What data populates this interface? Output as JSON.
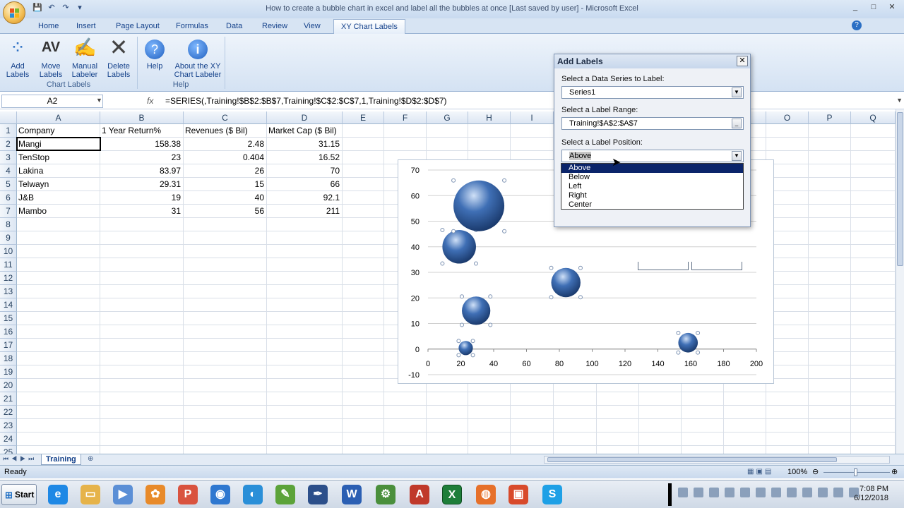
{
  "window": {
    "title": "How to create a bubble chart in excel and label all the bubbles at once [Last saved by user] - Microsoft Excel",
    "controls": [
      "_",
      "□",
      "✕"
    ]
  },
  "ribbon_tabs": [
    "Home",
    "Insert",
    "Page Layout",
    "Formulas",
    "Data",
    "Review",
    "View",
    "XY Chart Labels"
  ],
  "active_tab": "XY Chart Labels",
  "ribbon": {
    "chart_labels": {
      "group": "Chart Labels",
      "buttons": [
        {
          "icon": "add-labels-icon",
          "label1": "Add",
          "label2": "Labels"
        },
        {
          "icon": "move-labels-icon",
          "label1": "Move",
          "label2": "Labels"
        },
        {
          "icon": "manual-labeler-icon",
          "label1": "Manual",
          "label2": "Labeler"
        },
        {
          "icon": "delete-labels-icon",
          "label1": "Delete",
          "label2": "Labels"
        }
      ]
    },
    "help": {
      "group": "Help",
      "buttons": [
        {
          "icon": "help-icon",
          "label1": "Help",
          "label2": ""
        },
        {
          "icon": "info-icon",
          "label1": "About the XY",
          "label2": "Chart Labeler"
        }
      ]
    }
  },
  "formula_bar": {
    "name_box": "A2",
    "fx": "fx",
    "formula": "=SERIES(,Training!$B$2:$B$7,Training!$C$2:$C$7,1,Training!$D$2:$D$7)"
  },
  "columns": [
    "A",
    "B",
    "C",
    "D",
    "E",
    "F",
    "G",
    "H",
    "I",
    "J",
    "K",
    "L",
    "M",
    "N",
    "O",
    "P",
    "Q"
  ],
  "rows": [
    "1",
    "2",
    "3",
    "4",
    "5",
    "6",
    "7",
    "8",
    "9",
    "10",
    "11",
    "12",
    "13",
    "14",
    "15",
    "16",
    "17",
    "18",
    "19",
    "20",
    "21",
    "22",
    "23",
    "24",
    "25"
  ],
  "table": {
    "headers": [
      "Company",
      "1 Year Return%",
      "Revenues ($ Bil)",
      "Market Cap ($ Bil)"
    ],
    "rows": [
      [
        "Mangi",
        "158.38",
        "2.48",
        "31.15"
      ],
      [
        "TenStop",
        "23",
        "0.404",
        "16.52"
      ],
      [
        "Lakina",
        "83.97",
        "26",
        "70"
      ],
      [
        "Telwayn",
        "29.31",
        "15",
        "66"
      ],
      [
        "J&B",
        "19",
        "40",
        "92.1"
      ],
      [
        "Mambo",
        "31",
        "56",
        "211"
      ]
    ]
  },
  "sheet_tab": "Training",
  "status": {
    "left": "Ready",
    "zoom": "100%"
  },
  "chart_data": {
    "type": "scatter",
    "subtype": "bubble",
    "series": [
      {
        "x": [
          158.38,
          23,
          83.97,
          29.31,
          19,
          31
        ],
        "y": [
          2.48,
          0.404,
          26,
          15,
          40,
          56
        ],
        "size": [
          31.15,
          16.52,
          70,
          66,
          92.1,
          211
        ]
      }
    ],
    "x_ticks": [
      "0",
      "20",
      "40",
      "60",
      "80",
      "100",
      "120",
      "140",
      "160",
      "180",
      "200"
    ],
    "y_ticks": [
      "70",
      "60",
      "50",
      "40",
      "30",
      "20",
      "10",
      "0",
      "-10"
    ],
    "xlim": [
      0,
      200
    ],
    "ylim": [
      -10,
      70
    ],
    "grid": true,
    "bubble_color": "#3f6fb5"
  },
  "dialog": {
    "title": "Add Labels",
    "close": "✕",
    "series_label": "Select a Data Series to Label:",
    "series_value": "Series1",
    "range_label": "Select a Label Range:",
    "range_value": "Training!$A$2:$A$7",
    "position_label": "Select a Label Position:",
    "position_value": "Above",
    "position_options": [
      "Above",
      "Below",
      "Left",
      "Right",
      "Center"
    ]
  },
  "taskbar": {
    "start": "Start",
    "time": "7:08 PM",
    "date": "6/12/2018"
  }
}
